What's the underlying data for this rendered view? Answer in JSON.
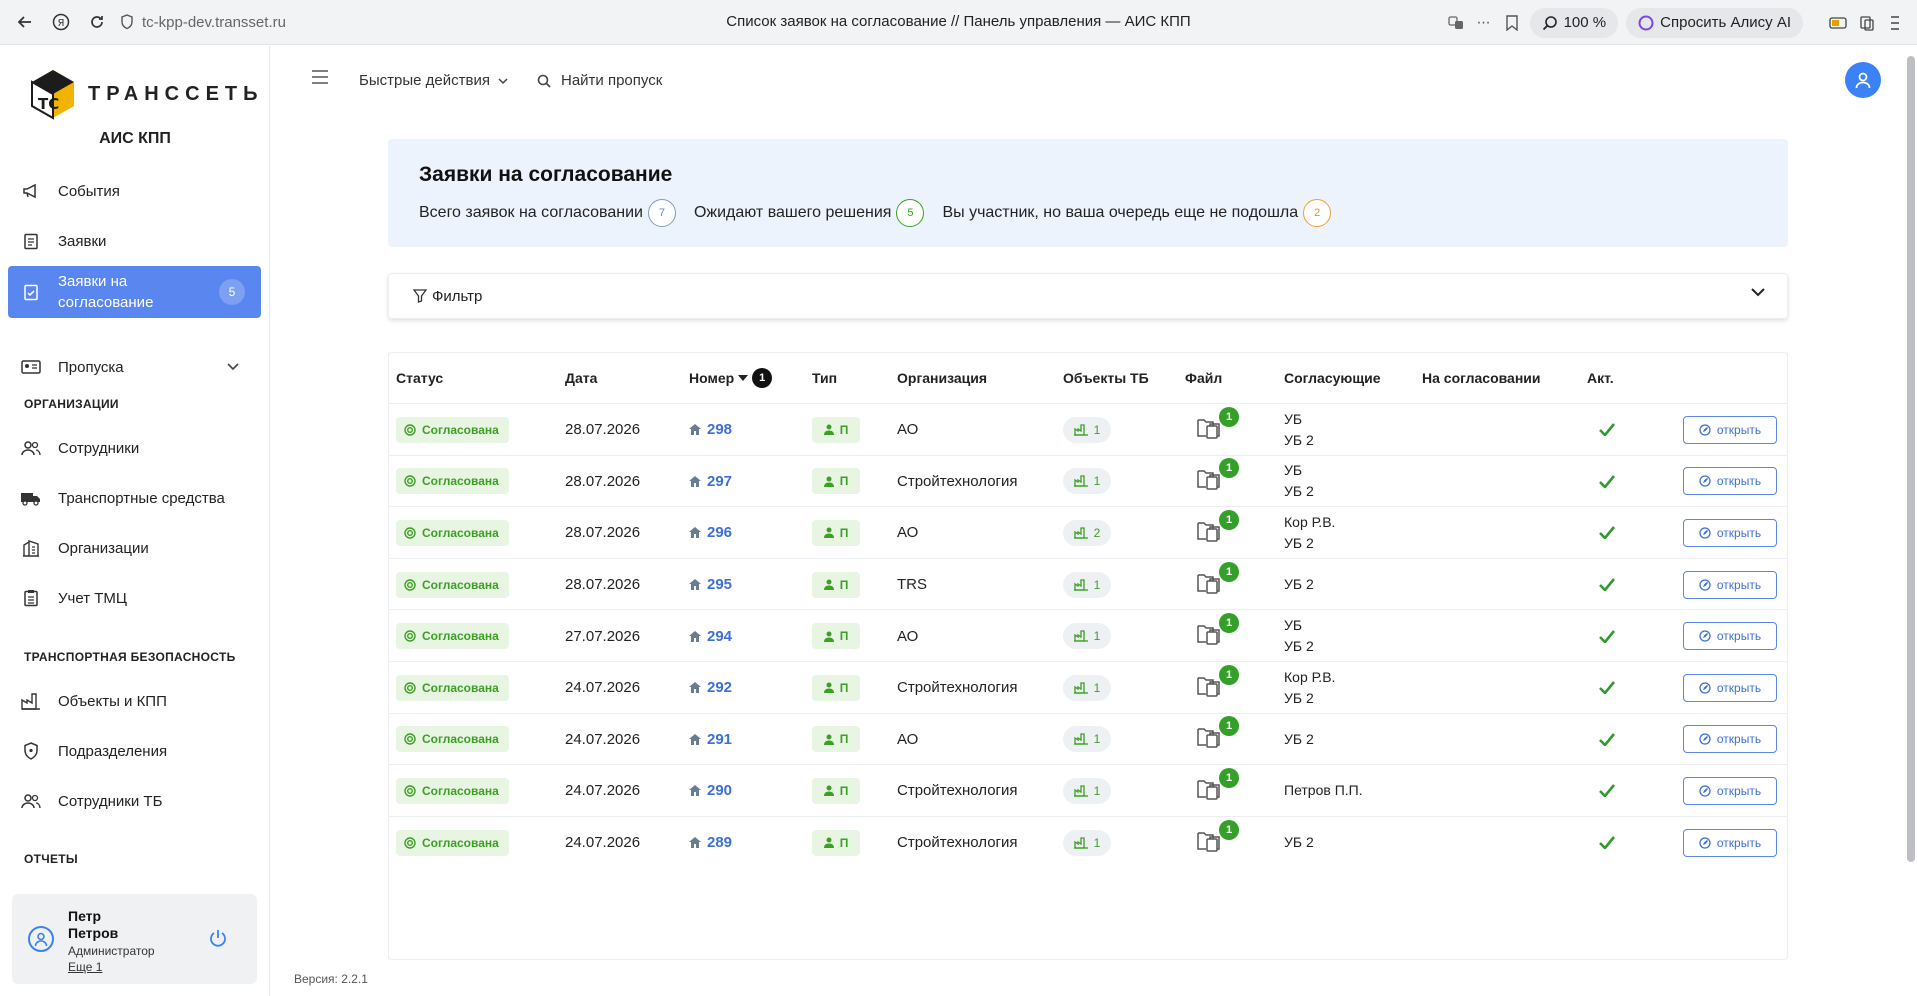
{
  "browser": {
    "url": "tc-kpp-dev.transset.ru",
    "title": "Список заявок на согласование // Панель управления — АИС КПП",
    "zoom": "100 %",
    "alice": "Спросить Алису AI"
  },
  "logo": {
    "text": "ТРАНССЕТЬ",
    "app": "АИС КПП"
  },
  "nav": {
    "events": "События",
    "requests": "Заявки",
    "approvals": "Заявки на согласование",
    "approvals_badge": "5",
    "passes": "Пропуска",
    "section_org": "ОРГАНИЗАЦИИ",
    "employees": "Сотрудники",
    "vehicles": "Транспортные средства",
    "organizations": "Организации",
    "tmc": "Учет ТМЦ",
    "section_tb": "ТРАНСПОРТНАЯ БЕЗОПАСНОСТЬ",
    "objects": "Объекты и КПП",
    "divisions": "Подразделения",
    "tb_employees": "Сотрудники ТБ",
    "section_reports": "ОТЧЕТЫ"
  },
  "user": {
    "first": "Петр",
    "last": "Петров",
    "role": "Администратор",
    "more": "Еще 1"
  },
  "version": "Версия: 2.2.1",
  "topbar": {
    "quick": "Быстрые действия",
    "find": "Найти пропуск"
  },
  "summary": {
    "title": "Заявки на согласование",
    "total_label": "Всего заявок на согласовании",
    "total": "7",
    "awaiting_label": "Ожидают вашего решения",
    "awaiting": "5",
    "queue_label": "Вы участник, но ваша очередь еще не подошла",
    "queue": "2"
  },
  "filter": {
    "label": "Фильтр"
  },
  "table": {
    "headers": {
      "status": "Статус",
      "date": "Дата",
      "number": "Номер",
      "number_sort_badge": "1",
      "type": "Тип",
      "org": "Организация",
      "objects": "Объекты ТБ",
      "file": "Файл",
      "approvers": "Согласующие",
      "on_approval": "На согласовании",
      "act": "Акт."
    },
    "rows": [
      {
        "status": "Согласована",
        "date": "28.07.2026",
        "number": "298",
        "type": "П",
        "org": "АО",
        "objects": "1",
        "files": "1",
        "approvers": [
          "УБ",
          "УБ 2"
        ],
        "on_approval": "",
        "open": "открыть"
      },
      {
        "status": "Согласована",
        "date": "28.07.2026",
        "number": "297",
        "type": "П",
        "org": "Стройтехнология",
        "objects": "1",
        "files": "1",
        "approvers": [
          "УБ",
          "УБ 2"
        ],
        "on_approval": "",
        "open": "открыть"
      },
      {
        "status": "Согласована",
        "date": "28.07.2026",
        "number": "296",
        "type": "П",
        "org": "АО",
        "objects": "2",
        "files": "1",
        "approvers": [
          "Кор Р.В.",
          "УБ 2"
        ],
        "on_approval": "",
        "open": "открыть"
      },
      {
        "status": "Согласована",
        "date": "28.07.2026",
        "number": "295",
        "type": "П",
        "org": "TRS",
        "objects": "1",
        "files": "1",
        "approvers": [
          "УБ 2"
        ],
        "on_approval": "",
        "open": "открыть"
      },
      {
        "status": "Согласована",
        "date": "27.07.2026",
        "number": "294",
        "type": "П",
        "org": "АО",
        "objects": "1",
        "files": "1",
        "approvers": [
          "УБ",
          "УБ 2"
        ],
        "on_approval": "",
        "open": "открыть"
      },
      {
        "status": "Согласована",
        "date": "24.07.2026",
        "number": "292",
        "type": "П",
        "org": "Стройтехнология",
        "objects": "1",
        "files": "1",
        "approvers": [
          "Кор Р.В.",
          "УБ 2"
        ],
        "on_approval": "",
        "open": "открыть"
      },
      {
        "status": "Согласована",
        "date": "24.07.2026",
        "number": "291",
        "type": "П",
        "org": "АО",
        "objects": "1",
        "files": "1",
        "approvers": [
          "УБ 2"
        ],
        "on_approval": "",
        "open": "открыть"
      },
      {
        "status": "Согласована",
        "date": "24.07.2026",
        "number": "290",
        "type": "П",
        "org": "Стройтехнология",
        "objects": "1",
        "files": "1",
        "approvers": [
          "Петров П.П."
        ],
        "on_approval": "",
        "open": "открыть"
      },
      {
        "status": "Согласована",
        "date": "24.07.2026",
        "number": "289",
        "type": "П",
        "org": "Стройтехнология",
        "objects": "1",
        "files": "1",
        "approvers": [
          "УБ 2"
        ],
        "on_approval": "",
        "open": "открыть"
      }
    ]
  },
  "colors": {
    "accent": "#5a86f0",
    "success": "#3ba024",
    "link": "#3d6fd8",
    "warning": "#f0a030"
  }
}
